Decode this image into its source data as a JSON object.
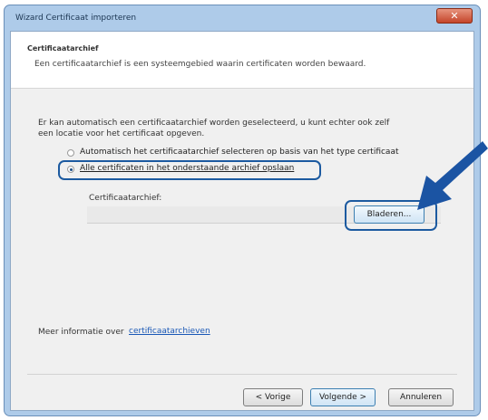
{
  "window": {
    "title": "Wizard Certificaat importeren",
    "close_glyph": "✕"
  },
  "header": {
    "title": "Certificaatarchief",
    "subtitle": "Een certificaatarchief is een systeemgebied waarin certificaten worden bewaard."
  },
  "body": {
    "intro_line1": "Er kan automatisch een certificaatarchief worden geselecteerd, u kunt echter ook zelf",
    "intro_line2": "een locatie voor het certificaat opgeven.",
    "radio_auto": {
      "label": "Automatisch het certificaatarchief selecteren op basis van het type certificaat",
      "selected": false
    },
    "radio_manual": {
      "label": "Alle certificaten in het onderstaande archief opslaan",
      "selected": true
    },
    "store_label": "Certificaatarchief:",
    "store_value": "",
    "browse_label": "Bladeren..."
  },
  "footer": {
    "more_info_prefix": "Meer informatie over",
    "more_info_link": "certificaatarchieven",
    "back_label": "< Vorige",
    "next_label": "Volgende >",
    "cancel_label": "Annuleren"
  },
  "colors": {
    "highlight": "#1c5aa0",
    "arrow": "#1b54a3"
  }
}
